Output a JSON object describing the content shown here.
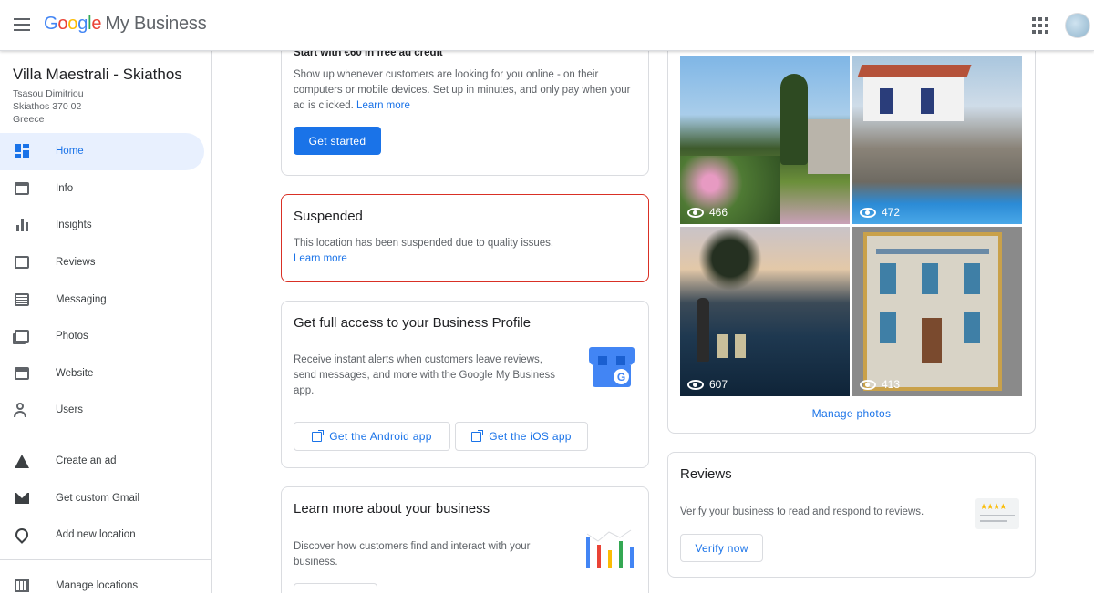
{
  "header": {
    "brand_google": [
      "G",
      "o",
      "o",
      "g",
      "l",
      "e"
    ],
    "brand_rest": "My Business"
  },
  "sidebar": {
    "business_name": "Villa Maestrali - Skiathos",
    "address_lines": [
      "Tsasou Dimitriou",
      "Skiathos 370 02",
      "Greece"
    ],
    "items": [
      {
        "label": "Home",
        "icon": "dashboard-icon",
        "active": true
      },
      {
        "label": "Info",
        "icon": "storefront-icon"
      },
      {
        "label": "Insights",
        "icon": "bar-chart-icon"
      },
      {
        "label": "Reviews",
        "icon": "rate-review-icon"
      },
      {
        "label": "Messaging",
        "icon": "message-icon"
      },
      {
        "label": "Photos",
        "icon": "photo-library-icon"
      },
      {
        "label": "Website",
        "icon": "web-icon"
      },
      {
        "label": "Users",
        "icon": "person-add-icon"
      }
    ],
    "secondary_items": [
      {
        "label": "Create an ad",
        "icon": "google-ads-icon"
      },
      {
        "label": "Get custom Gmail",
        "icon": "gmail-icon"
      },
      {
        "label": "Add new location",
        "icon": "add-location-icon"
      }
    ],
    "tertiary_items": [
      {
        "label": "Manage locations",
        "icon": "business-icon"
      }
    ]
  },
  "ad_card": {
    "title": "Start with €60 in free ad credit",
    "body": "Show up whenever customers are looking for you online - on their computers or mobile devices. Set up in minutes, and only pay when your ad is clicked.",
    "learn_more": "Learn more",
    "button": "Get started"
  },
  "suspended_card": {
    "title": "Suspended",
    "body": "This location has been suspended due to quality issues.",
    "learn_more": "Learn more"
  },
  "access_card": {
    "title": "Get full access to your Business Profile",
    "body": "Receive instant alerts when customers leave reviews, send messages, and more with the Google My Business app.",
    "android_button": "Get the Android app",
    "ios_button": "Get the iOS app"
  },
  "learn_card": {
    "title": "Learn more about your business",
    "body": "Discover how customers find and interact with your business."
  },
  "photos_card": {
    "photos": [
      {
        "views": "466",
        "subject": "garden-with-stone-house"
      },
      {
        "views": "472",
        "subject": "house-with-pool"
      },
      {
        "views": "607",
        "subject": "pool-at-sunset"
      },
      {
        "views": "413",
        "subject": "painting-of-house"
      }
    ],
    "manage_link": "Manage photos"
  },
  "reviews_card": {
    "title": "Reviews",
    "body": "Verify your business to read and respond to reviews.",
    "button": "Verify now"
  },
  "colors": {
    "accent": "#1a73e8",
    "suspended_border": "#d93025",
    "active_bg": "#e8f0fe"
  }
}
